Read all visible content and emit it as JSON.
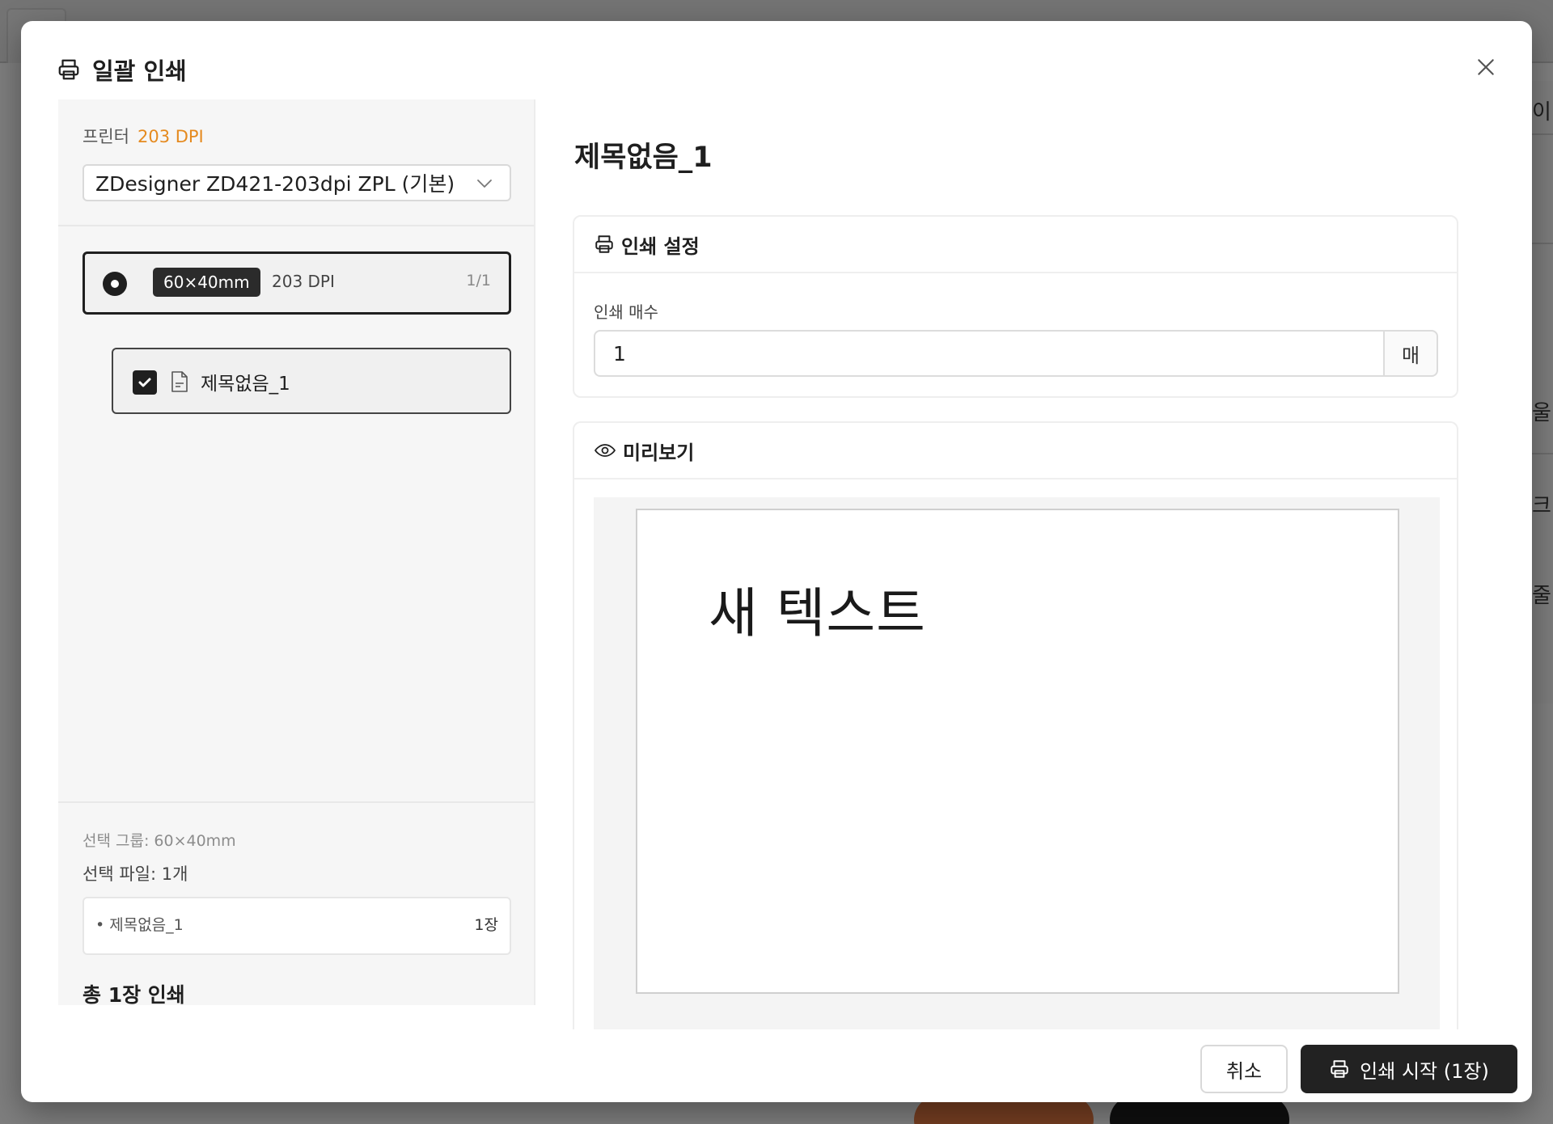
{
  "background": {
    "fragments": [
      "이",
      "울",
      "크",
      "줄"
    ]
  },
  "modal": {
    "title": "일괄 인쇄",
    "icons": {
      "header": "printer-icon",
      "close": "close-icon"
    }
  },
  "printer": {
    "label": "프린터",
    "dpi": "203 DPI",
    "selected": "ZDesigner ZD421-203dpi ZPL (기본)"
  },
  "group": {
    "size": "60×40mm",
    "dpi": "203 DPI",
    "count": "1/1"
  },
  "file": {
    "name": "제목없음_1",
    "checked": true
  },
  "summary": {
    "group": "선택 그룹: 60×40mm",
    "files": "선택 파일: 1개",
    "items": [
      {
        "name": "• 제목없음_1",
        "count": "1장"
      }
    ],
    "total": "총 1장 인쇄"
  },
  "document": {
    "title": "제목없음_1"
  },
  "settings": {
    "title": "인쇄 설정",
    "copies_label": "인쇄 매수",
    "copies_value": "1",
    "copies_unit": "매"
  },
  "preview": {
    "title": "미리보기",
    "label_text": "새 텍스트"
  },
  "footer": {
    "cancel": "취소",
    "start": "인쇄 시작 (1장)"
  }
}
